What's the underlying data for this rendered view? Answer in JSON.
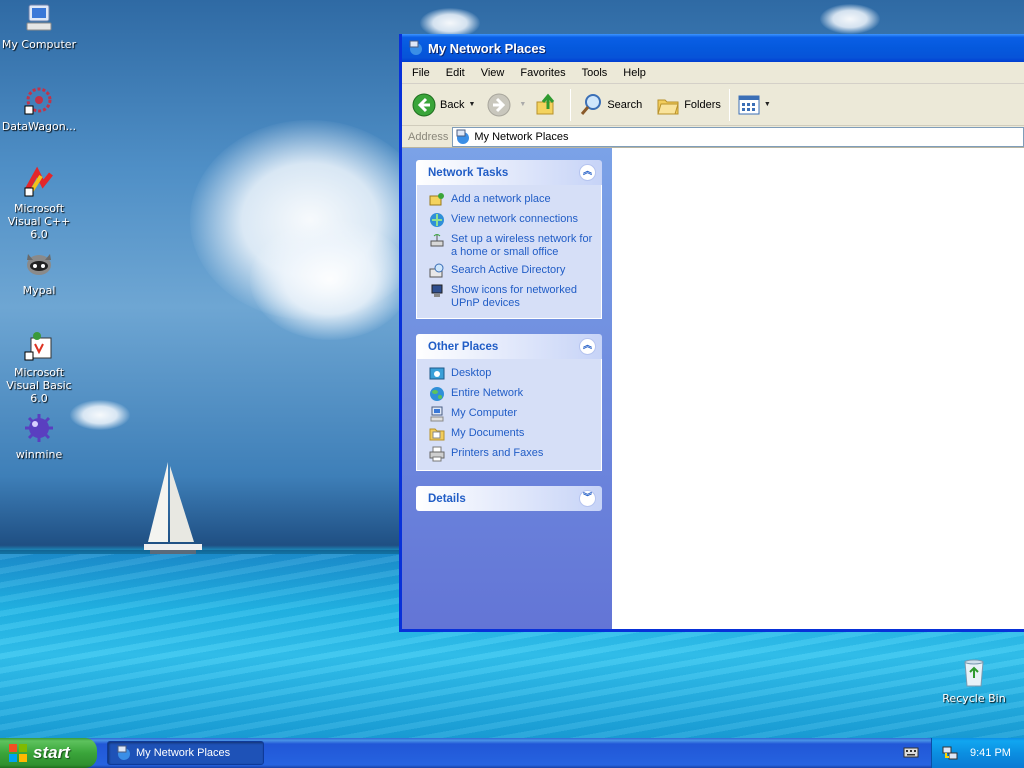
{
  "desktop": {
    "icons": [
      {
        "label": "My Computer",
        "icon": "computer-icon"
      },
      {
        "label": "DataWagon...",
        "icon": "datawagon-icon"
      },
      {
        "label": "Microsoft Visual C++ 6.0",
        "icon": "visual-cpp-icon"
      },
      {
        "label": "Mypal",
        "icon": "mypal-icon"
      },
      {
        "label": "Microsoft Visual Basic 6.0",
        "icon": "visual-basic-icon"
      },
      {
        "label": "winmine",
        "icon": "winmine-icon"
      }
    ],
    "recycle_bin": {
      "label": "Recycle Bin",
      "icon": "recycle-bin-icon"
    }
  },
  "window": {
    "title": "My Network Places",
    "menu": [
      "File",
      "Edit",
      "View",
      "Favorites",
      "Tools",
      "Help"
    ],
    "toolbar": {
      "back_label": "Back",
      "search_label": "Search",
      "folders_label": "Folders"
    },
    "address": {
      "label": "Address",
      "value": "My Network Places"
    },
    "panels": {
      "network_tasks": {
        "title": "Network Tasks",
        "items": [
          {
            "label": "Add a network place",
            "icon": "add-network-place-icon"
          },
          {
            "label": "View network connections",
            "icon": "network-connections-icon"
          },
          {
            "label": "Set up a wireless network for a home or small office",
            "icon": "wireless-network-icon"
          },
          {
            "label": "Search Active Directory",
            "icon": "search-directory-icon"
          },
          {
            "label": "Show icons for networked UPnP devices",
            "icon": "upnp-devices-icon"
          }
        ]
      },
      "other_places": {
        "title": "Other Places",
        "items": [
          {
            "label": "Desktop",
            "icon": "desktop-icon"
          },
          {
            "label": "Entire Network",
            "icon": "entire-network-icon"
          },
          {
            "label": "My Computer",
            "icon": "my-computer-icon"
          },
          {
            "label": "My Documents",
            "icon": "my-documents-icon"
          },
          {
            "label": "Printers and Faxes",
            "icon": "printer-icon"
          }
        ]
      },
      "details": {
        "title": "Details"
      }
    }
  },
  "taskbar": {
    "start_label": "start",
    "task_label": "My Network Places",
    "clock": "9:41 PM"
  },
  "colors": {
    "title_blue": "#0559dd",
    "link_blue": "#215dc6",
    "taskpane_top": "#7ba2e7",
    "start_green": "#3aa53a"
  }
}
